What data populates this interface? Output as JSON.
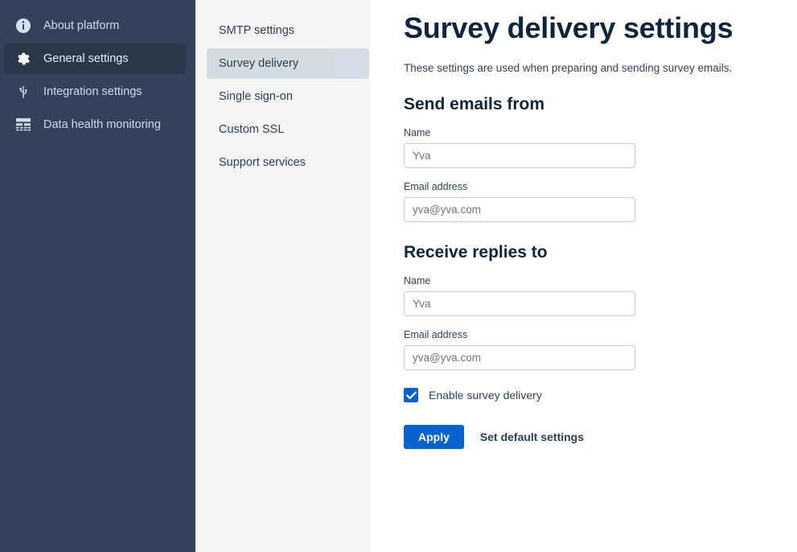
{
  "sidebar": {
    "items": [
      {
        "label": "About platform",
        "icon": "info-circle-icon",
        "active": false
      },
      {
        "label": "General settings",
        "icon": "gear-icon",
        "active": true
      },
      {
        "label": "Integration settings",
        "icon": "usb-plug-icon",
        "active": false
      },
      {
        "label": "Data health monitoring",
        "icon": "data-table-icon",
        "active": false
      }
    ]
  },
  "subnav": {
    "items": [
      {
        "label": "SMTP settings",
        "active": false
      },
      {
        "label": "Survey delivery",
        "active": true
      },
      {
        "label": "Single sign-on",
        "active": false
      },
      {
        "label": "Custom SSL",
        "active": false
      },
      {
        "label": "Support services",
        "active": false
      }
    ]
  },
  "main": {
    "title": "Survey delivery settings",
    "description": "These settings are used when preparing and sending survey emails.",
    "sections": [
      {
        "heading": "Send emails from",
        "name_label": "Name",
        "name_value": "",
        "name_placeholder": "Yva",
        "email_label": "Email address",
        "email_value": "",
        "email_placeholder": "yva@yva.com"
      },
      {
        "heading": "Receive replies to",
        "name_label": "Name",
        "name_value": "",
        "name_placeholder": "Yva",
        "email_label": "Email address",
        "email_value": "",
        "email_placeholder": "yva@yva.com"
      }
    ],
    "checkbox_label": "Enable survey delivery",
    "checkbox_checked": true,
    "apply_label": "Apply",
    "defaults_label": "Set default settings"
  },
  "colors": {
    "sidebar_bg": "#33425b",
    "sidebar_active_bg": "#2b384c",
    "subnav_bg": "#f5f5f6",
    "subnav_active_bg": "#d3dce0",
    "accent_blue": "#0a62d0",
    "title_text": "#10243e"
  }
}
